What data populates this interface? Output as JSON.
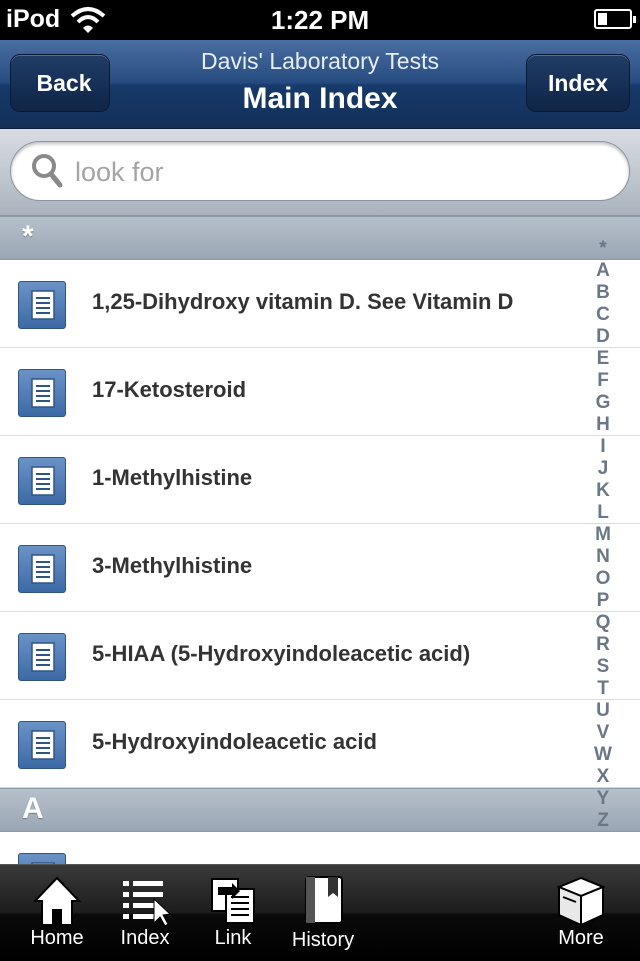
{
  "status_bar": {
    "carrier": "iPod",
    "time": "1:22 PM",
    "battery_level": 0.3
  },
  "nav": {
    "subtitle": "Davis' Laboratory Tests",
    "title": "Main Index",
    "back_label": "Back",
    "index_label": "Index"
  },
  "search": {
    "placeholder": "look for",
    "value": ""
  },
  "sections": [
    {
      "header": "*",
      "items": [
        "1,25-Dihydroxy vitamin D. See Vitamin D",
        "17-Ketosteroid",
        "1-Methylhistine",
        "3-Methylhistine",
        "5-HIAA (5-Hydroxyindoleacetic acid)",
        "5-Hydroxyindoleacetic acid"
      ]
    },
    {
      "header": "A",
      "items": []
    }
  ],
  "index_letters": [
    "*",
    "A",
    "B",
    "C",
    "D",
    "E",
    "F",
    "G",
    "H",
    "I",
    "J",
    "K",
    "L",
    "M",
    "N",
    "O",
    "P",
    "Q",
    "R",
    "S",
    "T",
    "U",
    "V",
    "W",
    "X",
    "Y",
    "Z"
  ],
  "tabbar": {
    "tabs": [
      {
        "label": "Home",
        "icon": "home-icon"
      },
      {
        "label": "Index",
        "icon": "list-icon"
      },
      {
        "label": "Link",
        "icon": "link-icon"
      },
      {
        "label": "History",
        "icon": "book-icon"
      },
      {
        "label": "More",
        "icon": "box-icon"
      }
    ]
  },
  "colors": {
    "nav_blue": "#274c80",
    "doc_icon_blue": "#4f7cb6",
    "section_header": "#a8b3bf"
  }
}
